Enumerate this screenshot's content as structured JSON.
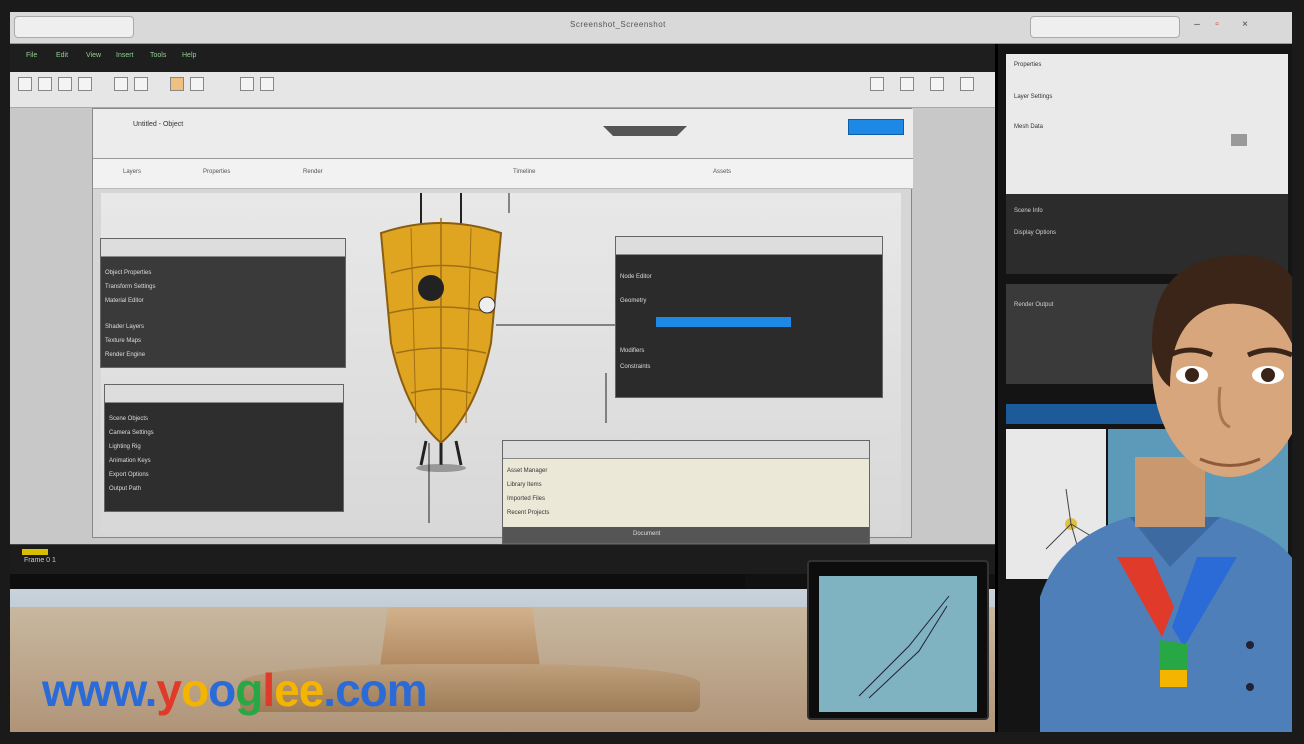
{
  "window": {
    "title": "Screenshot_Screenshot"
  },
  "app": {
    "menu_items": [
      "File",
      "Edit",
      "View",
      "Insert",
      "Tools",
      "Help"
    ],
    "doc_title": "Untitled - Object",
    "toolbar_texts": [
      "Layers",
      "Properties",
      "Render",
      "Timeline",
      "Assets"
    ]
  },
  "panel_left_top": {
    "rows": [
      "Object Properties",
      "Transform Settings",
      "Material Editor",
      "Shader Layers",
      "Texture Maps",
      "Render Engine"
    ]
  },
  "panel_left_bottom": {
    "rows": [
      "Scene Objects",
      "Camera Settings",
      "Lighting Rig",
      "Animation Keys",
      "Export Options",
      "Output Path"
    ]
  },
  "panel_right_top": {
    "rows": [
      "Node Editor",
      "Geometry",
      "Modifiers",
      "Constraints"
    ]
  },
  "panel_bottom_center": {
    "rows": [
      "Asset Manager",
      "Library Items",
      "Imported Files",
      "Recent Projects"
    ],
    "footer": "Document"
  },
  "timeline": {
    "label": "Frame 0 1"
  },
  "right_monitor": {
    "lines": [
      "Properties",
      "Layer Settings",
      "Mesh Data",
      "Scene Info",
      "Display Options",
      "Render Output"
    ]
  },
  "logo": {
    "parts": [
      {
        "text": "www.",
        "color": "#2a6bd8"
      },
      {
        "text": "y",
        "color": "#e03a2a"
      },
      {
        "text": "o",
        "color": "#f5b400"
      },
      {
        "text": "o",
        "color": "#2a6bd8"
      },
      {
        "text": "g",
        "color": "#28a745"
      },
      {
        "text": "l",
        "color": "#e03a2a"
      },
      {
        "text": "ee",
        "color": "#f5b400"
      },
      {
        "text": ".com",
        "color": "#2a6bd8"
      }
    ]
  },
  "colors": {
    "accent_blue": "#1e88e5",
    "object_yellow": "#e0a520"
  }
}
